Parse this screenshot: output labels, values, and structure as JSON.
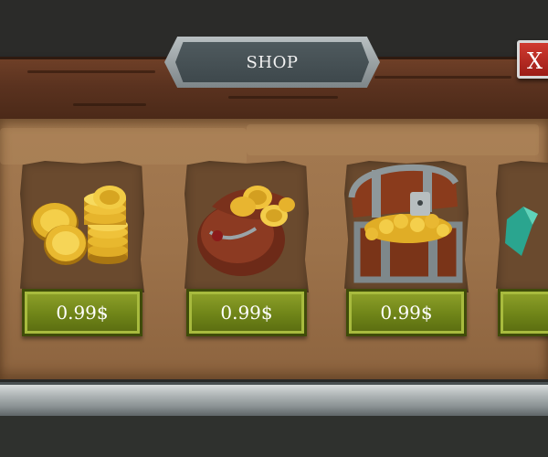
{
  "header": {
    "title": "SHOP",
    "close_label": "X"
  },
  "items": [
    {
      "name": "coin-stack",
      "price": "0.99$"
    },
    {
      "name": "coin-bag",
      "price": "0.99$"
    },
    {
      "name": "treasure-chest",
      "price": "0.99$"
    },
    {
      "name": "gem",
      "price": ""
    }
  ],
  "colors": {
    "wood": "#5a321f",
    "parchment": "#9c724a",
    "price_button": "#6f8418",
    "close_button": "#c0342b",
    "title_plate": "#4a5559"
  },
  "icons": [
    "coin-stack-icon",
    "coin-bag-icon",
    "treasure-chest-icon",
    "gem-icon"
  ]
}
